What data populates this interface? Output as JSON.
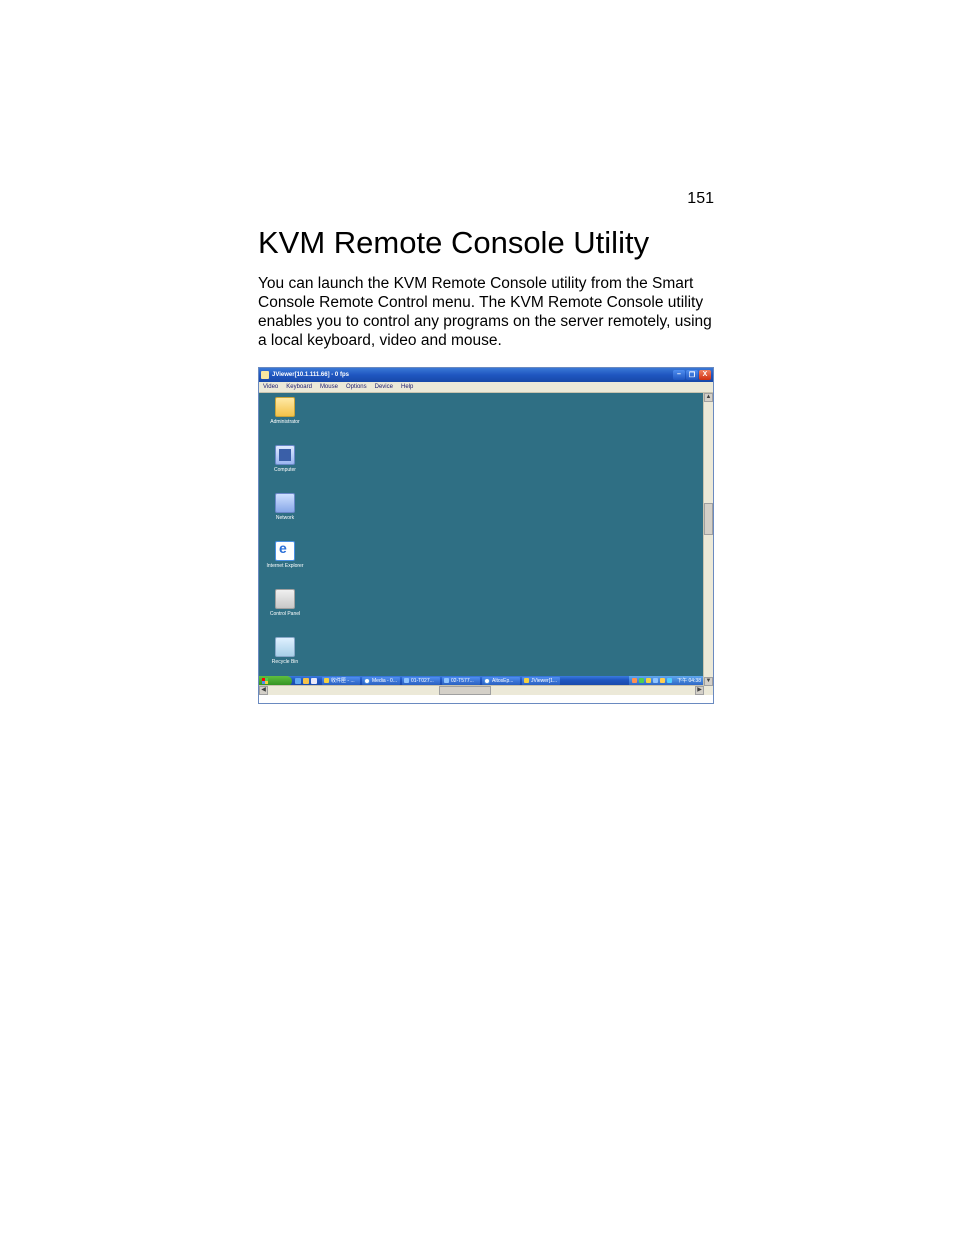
{
  "page_number": "151",
  "heading": "KVM Remote Console Utility",
  "paragraph": "You can launch the KVM Remote Console utility from the Smart Console Remote Control menu. The KVM Remote Console utility enables you to control any programs on the server remotely, using a local keyboard, video and mouse.",
  "window": {
    "title": "JViewer[10.1.111.66] - 0 fps",
    "menus": [
      "Video",
      "Keyboard",
      "Mouse",
      "Options",
      "Device",
      "Help"
    ],
    "controls": {
      "minimize": "–",
      "maximize": "❐",
      "close": "X"
    }
  },
  "desktop_icons": [
    {
      "label": "Administrator",
      "icon": "folder"
    },
    {
      "label": "Computer",
      "icon": "computer"
    },
    {
      "label": "Network",
      "icon": "network"
    },
    {
      "label": "Internet Explorer",
      "icon": "ie"
    },
    {
      "label": "Control Panel",
      "icon": "control"
    },
    {
      "label": "Recycle Bin",
      "icon": "recycle"
    },
    {
      "label": "",
      "icon": "folder"
    }
  ],
  "taskbar": {
    "items": [
      "收件匣 - ...",
      "Media - 0...",
      "01-T027...",
      "02-T577...",
      "AltosEp...",
      "JViewer[1..."
    ],
    "clock": "下午 04:38"
  }
}
